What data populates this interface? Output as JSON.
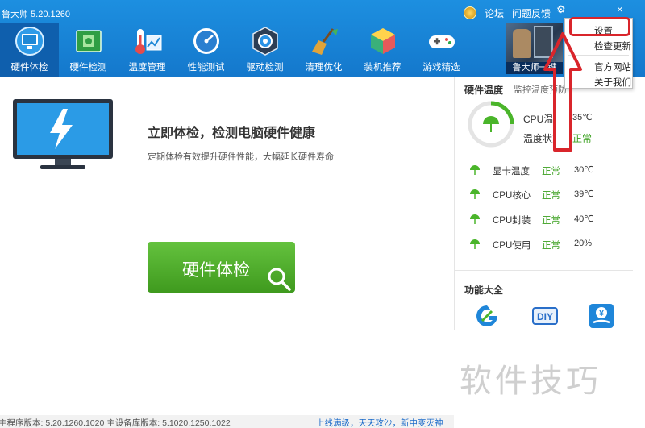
{
  "app": {
    "title": "鲁大师 5.20.1260"
  },
  "top_links": {
    "forum": "论坛",
    "feedback": "问题反馈",
    "gear_glyph": "⚙",
    "min_glyph": "—",
    "close_glyph": "×"
  },
  "nav": [
    {
      "label": "硬件体检",
      "icon": "monitor-icon",
      "active": true
    },
    {
      "label": "硬件检测",
      "icon": "circuit-board-icon",
      "active": false
    },
    {
      "label": "温度管理",
      "icon": "thermometer-icon",
      "active": false
    },
    {
      "label": "性能测试",
      "icon": "speedometer-icon",
      "active": false
    },
    {
      "label": "驱动检测",
      "icon": "driver-gear-icon",
      "active": false
    },
    {
      "label": "清理优化",
      "icon": "broom-icon",
      "active": false
    },
    {
      "label": "装机推荐",
      "icon": "cube-icon",
      "active": false
    },
    {
      "label": "游戏精选",
      "icon": "gamepad-icon",
      "active": false
    }
  ],
  "promo": {
    "label": "鲁大师一键"
  },
  "menu": {
    "items": [
      "设置",
      "检查更新",
      "官方网站",
      "关于我们"
    ]
  },
  "main": {
    "headline": "立即体检，检测电脑硬件健康",
    "subline": "定期体检有效提升硬件性能，大幅延长硬件寿命",
    "button_label": "硬件体检"
  },
  "panel": {
    "header": "硬件温度",
    "header_sub": "监控温度预防高",
    "cpu_temp_label": "CPU温度",
    "cpu_temp_value": "35℃",
    "temp_state_label": "温度状态",
    "temp_state_value": "正常",
    "sensors": [
      {
        "name": "显卡温度",
        "status": "正常",
        "value": "30℃"
      },
      {
        "name": "CPU核心",
        "status": "正常",
        "value": "39℃"
      },
      {
        "name": "CPU封装",
        "status": "正常",
        "value": "40℃"
      },
      {
        "name": "CPU使用",
        "status": "正常",
        "value": "20%"
      }
    ],
    "functions_title": "功能大全",
    "function_icons": [
      "g-logo-icon",
      "diy-icon",
      "money-hand-icon"
    ]
  },
  "status": {
    "left": "主程序版本: 5.20.1260.1020   主设备库版本: 5.1020.1250.1022",
    "right": "上线满级，天天攻沙，新中变灭神"
  },
  "watermark": "软件技巧",
  "colors": {
    "nav_bg": "#1478cc",
    "nav_active": "#0f5fad",
    "ok_green": "#3aa01e",
    "button_green": "#4caf2a",
    "highlight_red": "#d9252b"
  }
}
